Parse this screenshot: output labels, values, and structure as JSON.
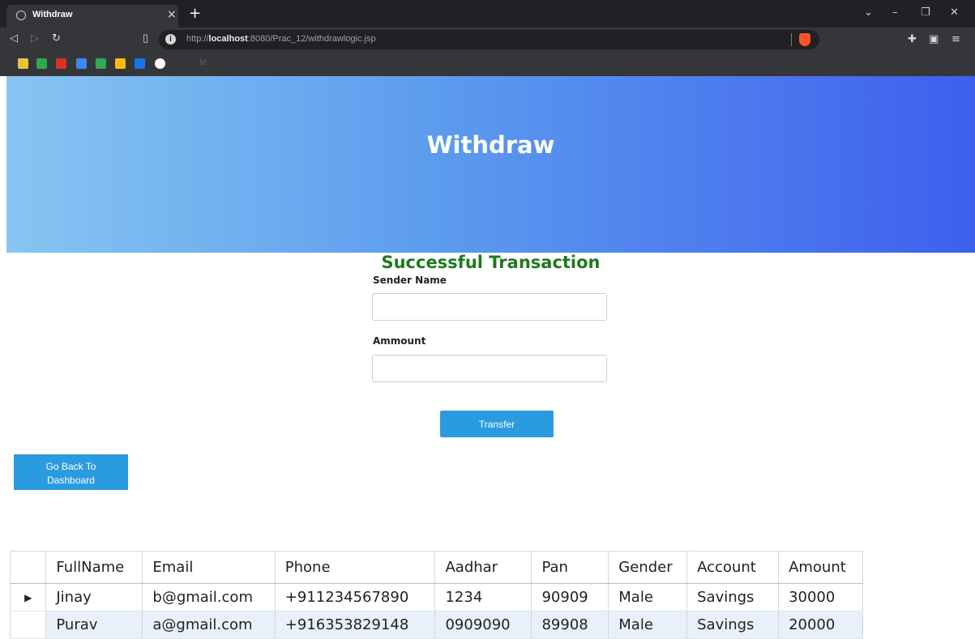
{
  "browser": {
    "tab_title": "Withdraw",
    "url_prefix": "http://",
    "url_host": "localhost",
    "url_rest": ":8080/Prac_12/withdrawlogic.jsp",
    "bookmark_text": "te"
  },
  "header": {
    "title": "Withdraw"
  },
  "form": {
    "status_message": "Successful Transaction",
    "sender_label": "Sender Name",
    "sender_value": "",
    "amount_label": "Ammount",
    "amount_value": "",
    "submit_label": "Transfer"
  },
  "back_button": {
    "line1": "Go Back To",
    "line2": "Dashboard"
  },
  "table": {
    "columns": [
      "FullName",
      "Email",
      "Phone",
      "Aadhar",
      "Pan",
      "Gender",
      "Account",
      "Amount"
    ],
    "rows": [
      [
        "Jinay",
        "b@gmail.com",
        "+911234567890",
        "1234",
        "90909",
        "Male",
        "Savings",
        "30000"
      ],
      [
        "Purav",
        "a@gmail.com",
        "+916353829148",
        "0909090",
        "89908",
        "Male",
        "Savings",
        "20000"
      ]
    ],
    "current_row_marker": "▶"
  },
  "colors": {
    "header_gradient_start": "#87c5f2",
    "header_gradient_end": "#3e5fee",
    "success_text": "#1f7a1f",
    "button": "#2b9be0",
    "selected_row": "#e8f1fb"
  }
}
